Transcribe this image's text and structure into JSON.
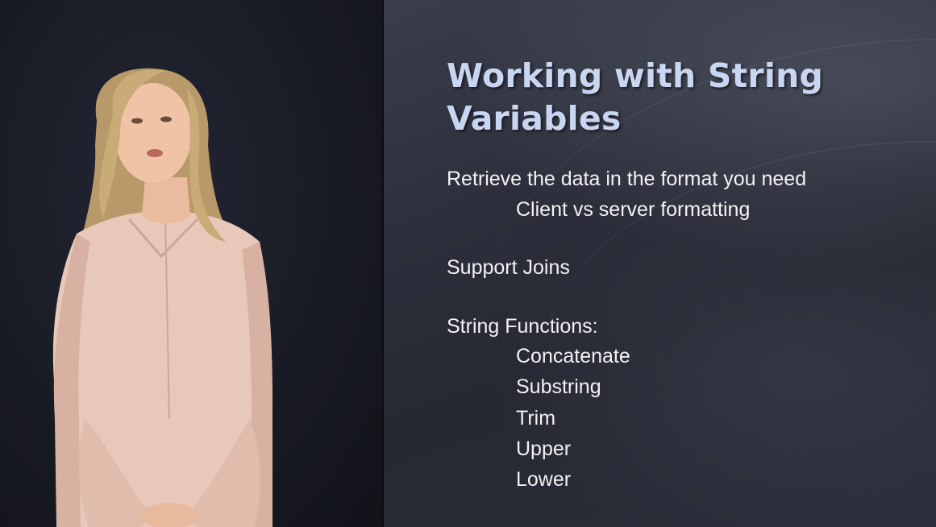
{
  "slide": {
    "title": "Working with String Variables",
    "items": [
      "Retrieve the data in the format you need",
      "Client vs server formatting",
      "Support Joins",
      "String Functions:",
      "Concatenate",
      "Substring",
      "Trim",
      "Upper",
      "Lower"
    ]
  },
  "colors": {
    "title": "#c9d6f2",
    "body_text": "#f2f2f2",
    "presenter_background": "#1b1d26",
    "slide_background": "#2e313d"
  }
}
